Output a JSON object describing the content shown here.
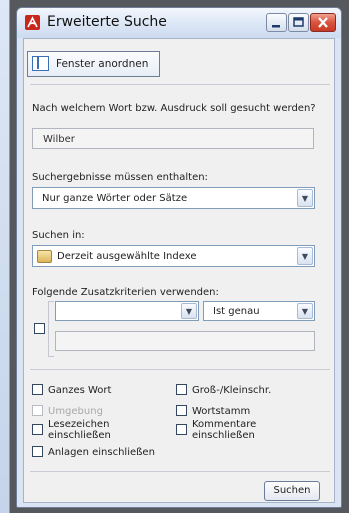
{
  "window": {
    "title": "Erweiterte Suche"
  },
  "toolbar": {
    "arrange_label": "Fenster anordnen"
  },
  "search": {
    "question": "Nach welchem Wort bzw. Ausdruck soll gesucht werden?",
    "value": "Wilber"
  },
  "results": {
    "label": "Suchergebnisse müssen enthalten:",
    "selected": "Nur ganze Wörter oder Sätze"
  },
  "scope": {
    "label": "Suchen in:",
    "selected": "Derzeit ausgewählte Indexe"
  },
  "criteria": {
    "label": "Folgende Zusatzkriterien verwenden:",
    "field_selected": "",
    "operator_selected": "Ist genau",
    "value": ""
  },
  "options": {
    "whole_word": "Ganzes Wort",
    "case_sensitive": "Groß-/Kleinschr.",
    "proximity": "Umgebung",
    "stemming": "Wortstamm",
    "bookmarks": "Lesezeichen einschließen",
    "comments": "Kommentare einschließen",
    "attachments": "Anlagen einschließen"
  },
  "actions": {
    "search_label": "Suchen"
  },
  "colors": {
    "titlebar": "#dbe6f6",
    "close": "#d9523d",
    "client": "#f0f0f0"
  }
}
